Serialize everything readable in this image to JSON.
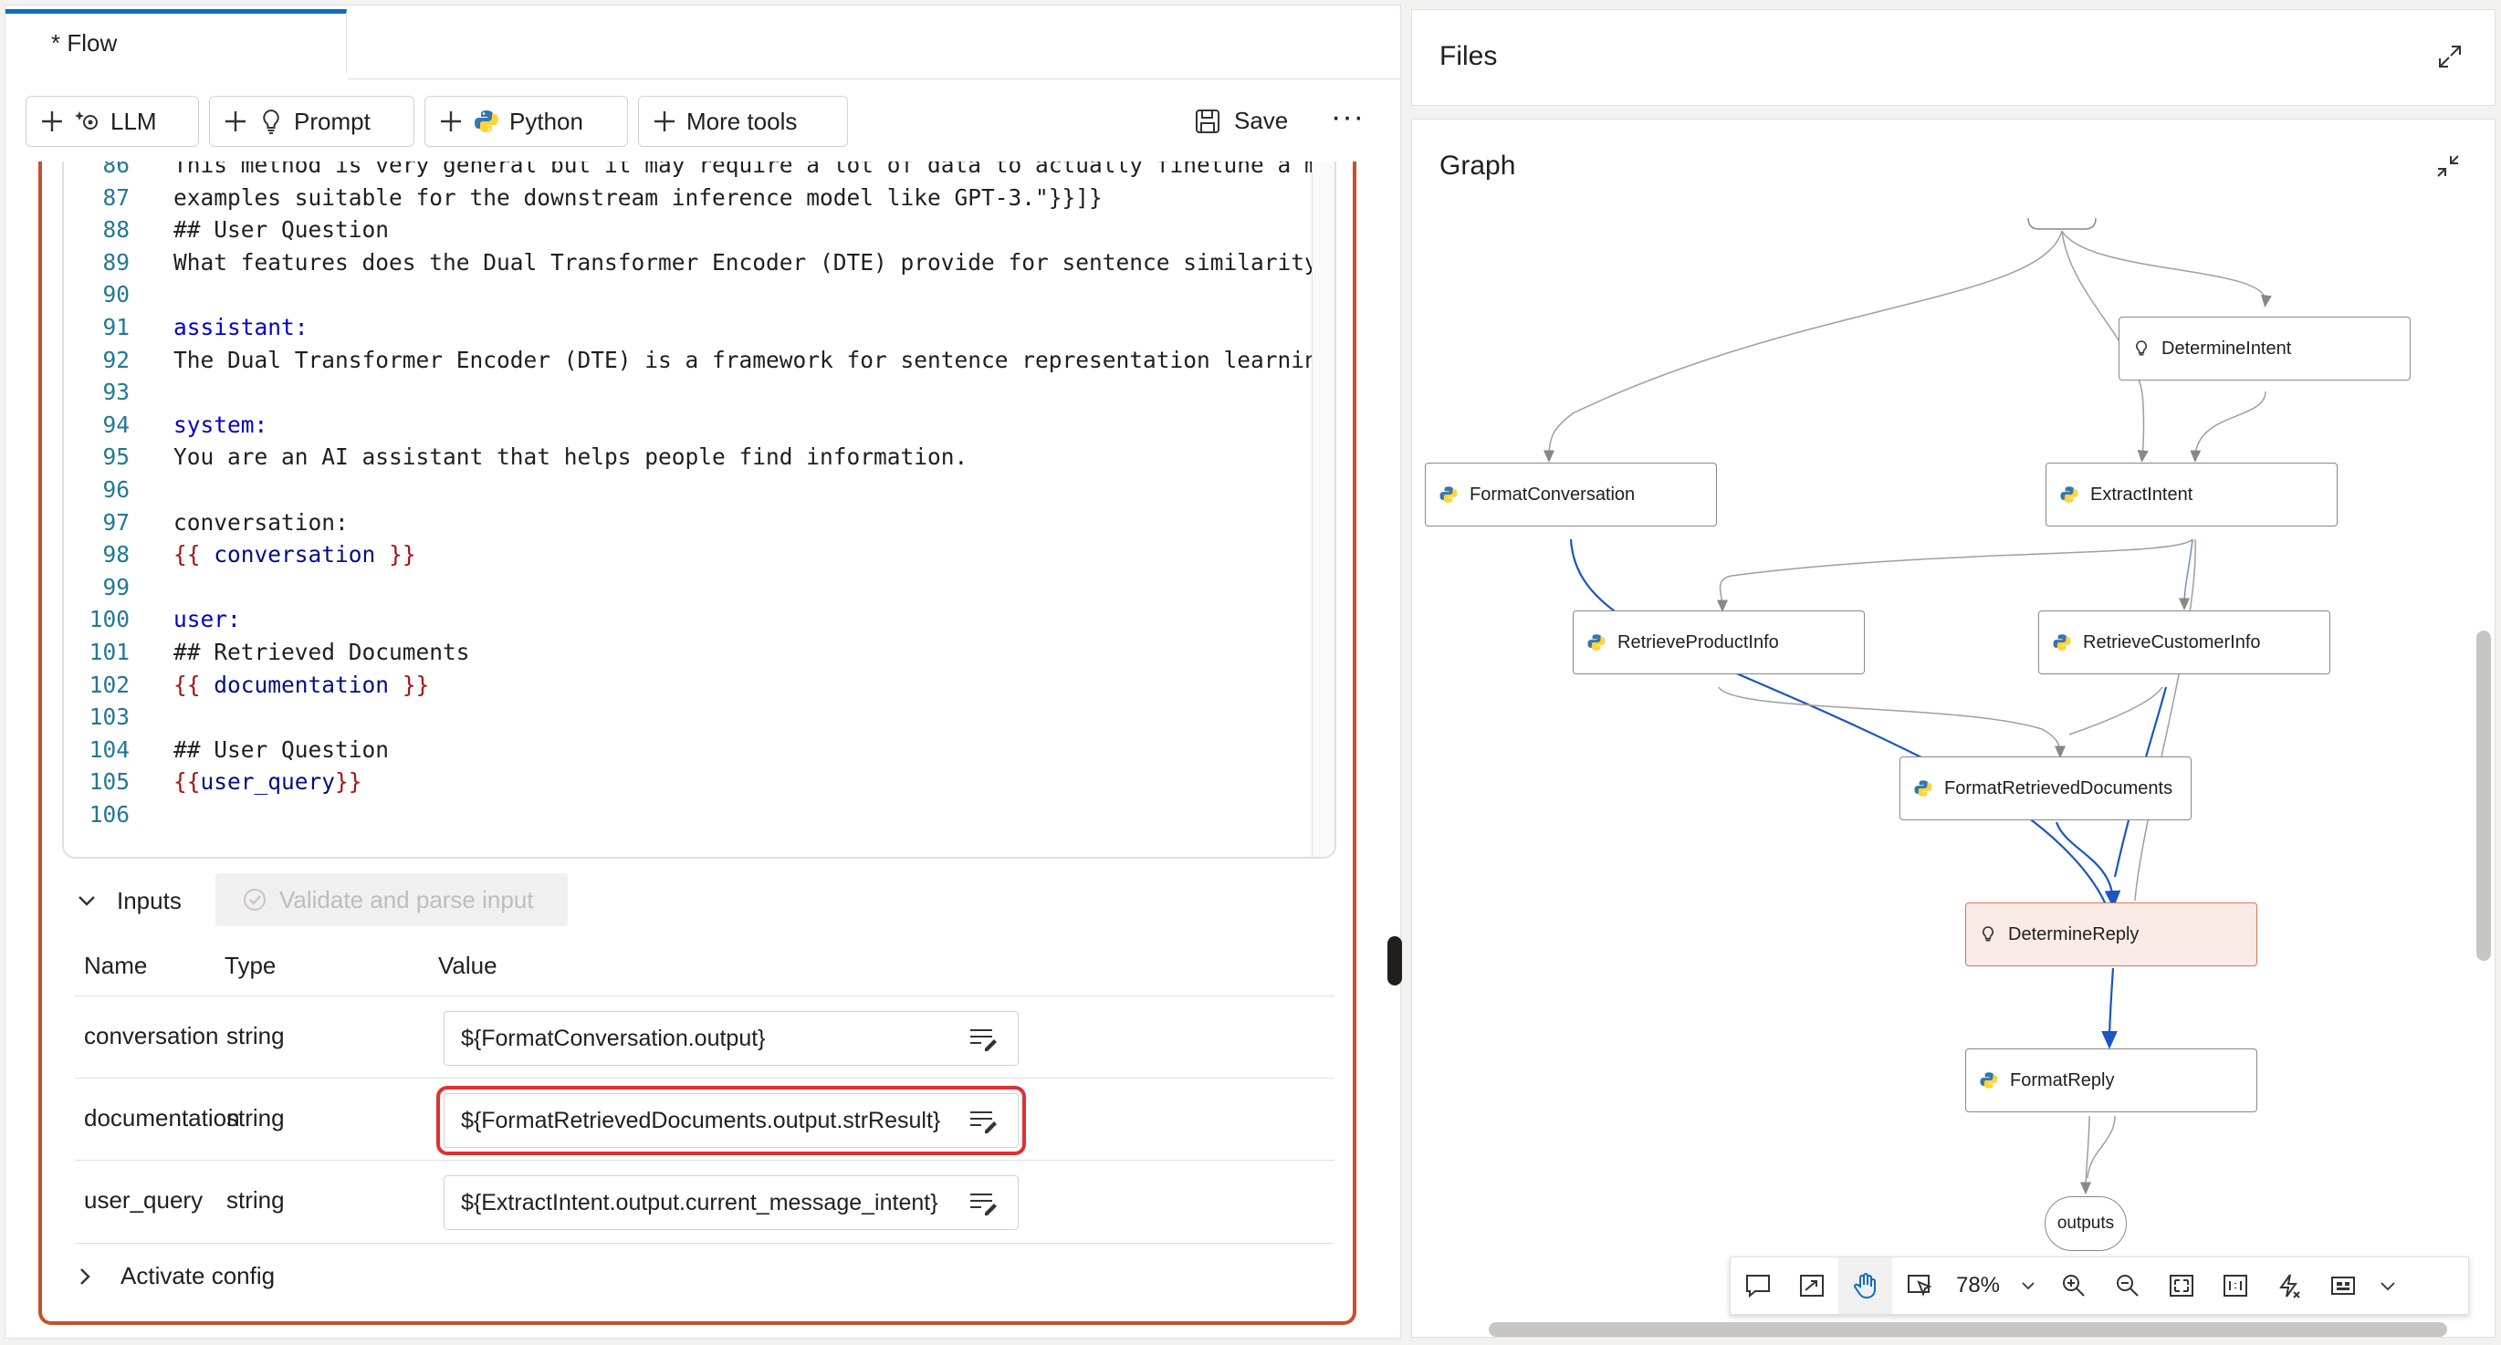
{
  "tab": {
    "title": "* Flow"
  },
  "toolbar": {
    "llm": "LLM",
    "prompt": "Prompt",
    "python": "Python",
    "more_tools": "More tools",
    "save": "Save",
    "more": "···"
  },
  "code_lines": [
    {
      "no": "86",
      "text": "This method is very general but it may require a lot of data to actually finetune a mode"
    },
    {
      "no": "87",
      "text": "examples suitable for the downstream inference model like GPT-3.\"}}]}"
    },
    {
      "no": "88",
      "text": "## User Question"
    },
    {
      "no": "89",
      "text": "What features does the Dual Transformer Encoder (DTE) provide for sentence similarity mo"
    },
    {
      "no": "90",
      "text": ""
    },
    {
      "no": "91",
      "text": "assistant:"
    },
    {
      "no": "92",
      "text": "The Dual Transformer Encoder (DTE) is a framework for sentence representation learning t"
    },
    {
      "no": "93",
      "text": ""
    },
    {
      "no": "94",
      "text": "system:"
    },
    {
      "no": "95",
      "text": "You are an AI assistant that helps people find information."
    },
    {
      "no": "96",
      "text": ""
    },
    {
      "no": "97",
      "text": "conversation:"
    },
    {
      "no": "98",
      "text": "{{ conversation }}"
    },
    {
      "no": "99",
      "text": ""
    },
    {
      "no": "100",
      "text": "user:"
    },
    {
      "no": "101",
      "text": "## Retrieved Documents"
    },
    {
      "no": "102",
      "text": "{{ documentation }}"
    },
    {
      "no": "103",
      "text": ""
    },
    {
      "no": "104",
      "text": "## User Question"
    },
    {
      "no": "105",
      "text": "{{user_query}}"
    },
    {
      "no": "106",
      "text": ""
    }
  ],
  "inputs": {
    "label": "Inputs",
    "validate": "Validate and parse input",
    "headers": {
      "name": "Name",
      "type": "Type",
      "value": "Value"
    },
    "rows": [
      {
        "name": "conversation",
        "type": "string",
        "value": "${FormatConversation.output}"
      },
      {
        "name": "documentation",
        "type": "string",
        "value": "${FormatRetrievedDocuments.output.strResult}"
      },
      {
        "name": "user_query",
        "type": "string",
        "value": "${ExtractIntent.output.current_message_intent}"
      }
    ],
    "activate": "Activate config"
  },
  "files": {
    "title": "Files"
  },
  "graph": {
    "title": "Graph",
    "zoom": "78%",
    "outputs": "outputs",
    "nodes": {
      "determine_intent": "DetermineIntent",
      "format_conversation": "FormatConversation",
      "extract_intent": "ExtractIntent",
      "retrieve_product": "RetrieveProductInfo",
      "retrieve_customer": "RetrieveCustomerInfo",
      "format_retrieved": "FormatRetrievedDocuments",
      "determine_reply": "DetermineReply",
      "format_reply": "FormatReply"
    }
  },
  "colors": {
    "accent": "#0f6cbd",
    "frame": "#c8502a",
    "highlight": "#e03030",
    "edge_active": "#1a56c4",
    "node_selected": "#fbebe6"
  }
}
